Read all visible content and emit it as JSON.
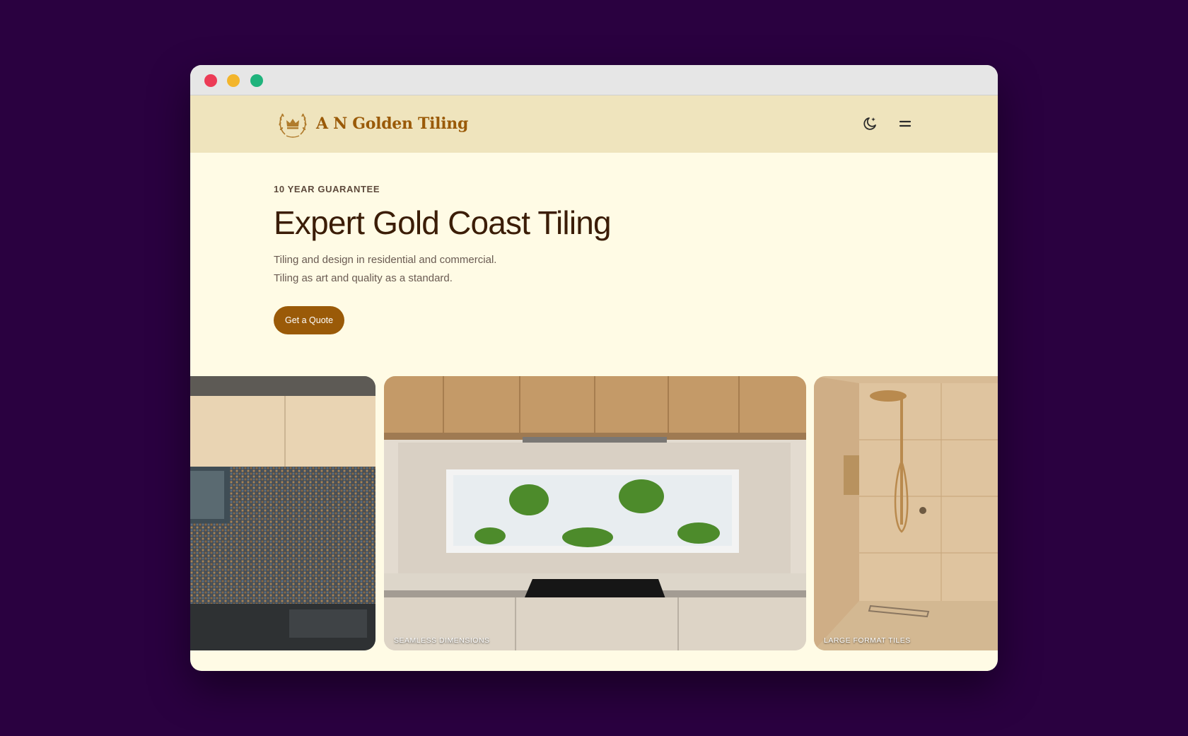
{
  "window": {
    "controls": [
      "close",
      "minimize",
      "maximize"
    ]
  },
  "navbar": {
    "brand_name": "A N Golden Tiling",
    "logo_icon": "crown-laurel-logo",
    "theme_toggle_icon": "moon-icon",
    "menu_icon": "menu-icon"
  },
  "hero": {
    "eyebrow": "10 YEAR GUARANTEE",
    "headline": "Expert Gold Coast Tiling",
    "subline_1": "Tiling and design in residential and commercial.",
    "subline_2": "Tiling as art and quality as a standard.",
    "cta_label": "Get a Quote"
  },
  "gallery": {
    "cards": [
      {
        "caption": ""
      },
      {
        "caption": "SEAMLESS DIMENSIONS"
      },
      {
        "caption": "LARGE FORMAT TILES"
      }
    ]
  },
  "colors": {
    "page_bg": "#2a0140",
    "content_bg": "#fffbe5",
    "navbar_bg": "#efe4bd",
    "brand": "#9a5a08",
    "headline": "#3b1d07"
  }
}
